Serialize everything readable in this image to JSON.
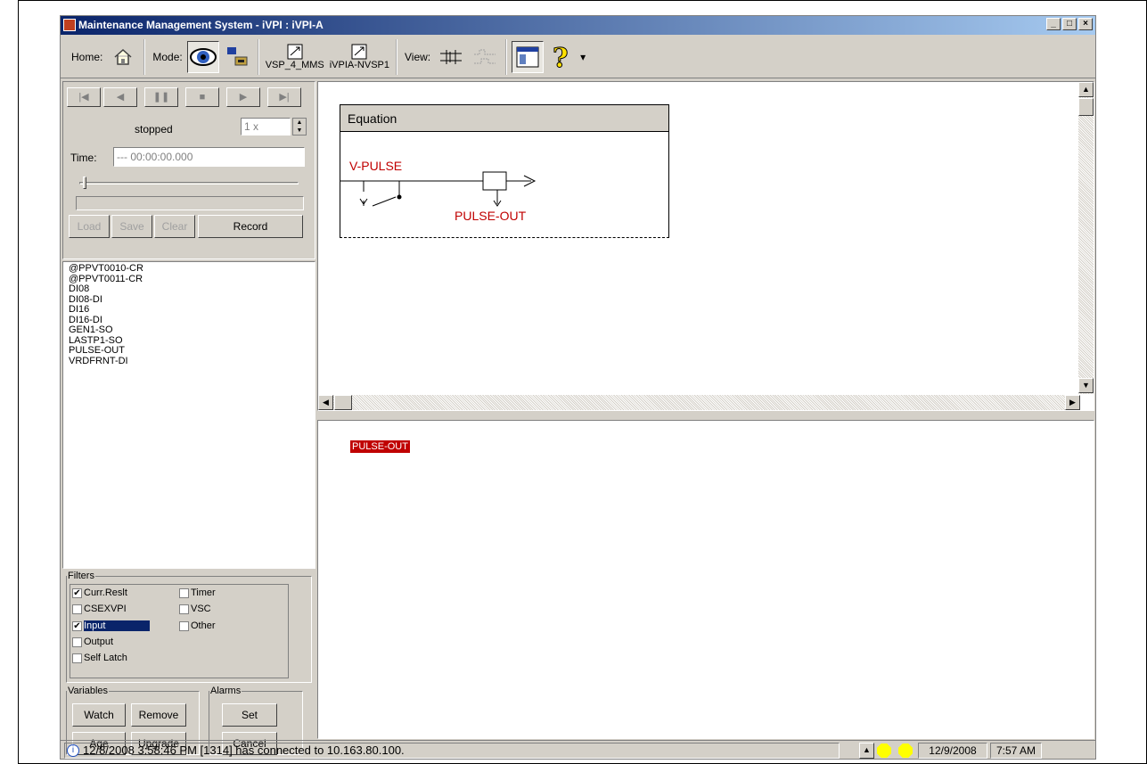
{
  "window": {
    "title": "Maintenance Management System - iVPI : iVPI-A",
    "minimize": "_",
    "maximize": "□",
    "close": "×"
  },
  "toolbar": {
    "home_label": "Home:",
    "mode_label": "Mode:",
    "view_label": "View:",
    "doc1": "VSP_4_MMS",
    "doc2": "iVPIA-NVSP1",
    "help_dropdown": "▾"
  },
  "playback": {
    "buttons": [
      "|◀",
      "◀",
      "❚❚",
      "■",
      "▶",
      "▶|"
    ],
    "status": "stopped",
    "speed": "1 x",
    "time_label": "Time:",
    "time_value": "--- 00:00:00.000",
    "load": "Load",
    "save": "Save",
    "clear": "Clear",
    "record": "Record"
  },
  "signals": [
    "@PPVT0010-CR",
    "@PPVT0011-CR",
    "DI08",
    "DI08-DI",
    "DI16",
    "DI16-DI",
    "GEN1-SO",
    "LASTP1-SO",
    "PULSE-OUT",
    "VRDFRNT-DI"
  ],
  "filters": {
    "legend": "Filters",
    "curr_reslt": "Curr.Reslt",
    "timer": "Timer",
    "csexvpi": "CSEXVPI",
    "vsc": "VSC",
    "input": "Input",
    "other": "Other",
    "output": "Output",
    "self_latch": "Self Latch"
  },
  "variables": {
    "legend": "Variables",
    "watch": "Watch",
    "remove": "Remove",
    "age": "Age",
    "upgrade": "Upgrade"
  },
  "alarms": {
    "legend": "Alarms",
    "set": "Set",
    "cancel": "Cancel"
  },
  "equation": {
    "header": "Equation",
    "input_label": "V-PULSE",
    "output_label": "PULSE-OUT"
  },
  "watch_panel": {
    "item": "PULSE-OUT",
    "item_color": "#c00000"
  },
  "statusbar": {
    "message": "12/8/2008 3:58:46 PM  [1314]  has connected to 10.163.80.100.",
    "date": "12/9/2008",
    "time": "7:57 AM",
    "led_color": "#ffff00"
  }
}
